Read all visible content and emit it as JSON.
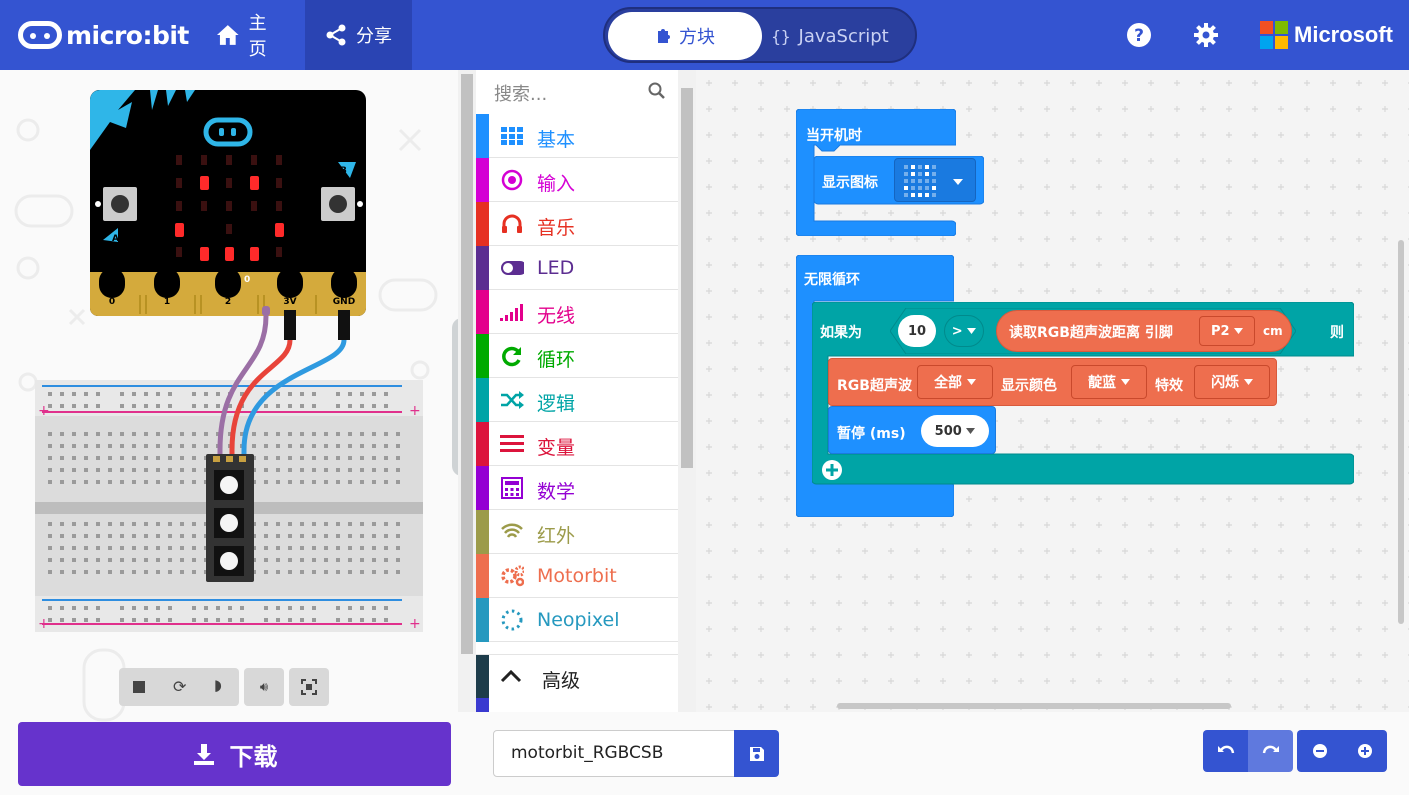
{
  "header": {
    "logo_text": "micro:bit",
    "nav_home": "主页",
    "nav_share": "分享",
    "mode_blocks": "方块",
    "mode_js": "JavaScript",
    "brand": "Microsoft",
    "brand_colors": [
      "#F25022",
      "#7FBA00",
      "#00A4EF",
      "#FFB900"
    ]
  },
  "simulator": {
    "pins": [
      "0",
      "1",
      "2",
      "3V",
      "GND"
    ],
    "button_a": "A",
    "button_b": "B",
    "pin_zero_label": "0"
  },
  "download": {
    "label": "下载"
  },
  "toolbox": {
    "search_placeholder": "搜索...",
    "categories": [
      {
        "label": "基本",
        "color": "#1E90FF",
        "icon": "grid-icon"
      },
      {
        "label": "输入",
        "color": "#D400D4",
        "icon": "radio-icon"
      },
      {
        "label": "音乐",
        "color": "#E63022",
        "icon": "headphones-icon"
      },
      {
        "label": "LED",
        "color": "#5C2D91",
        "icon": "toggle-icon"
      },
      {
        "label": "无线",
        "color": "#E3008C",
        "icon": "signal-bars-icon"
      },
      {
        "label": "循环",
        "color": "#00AA00",
        "icon": "refresh-icon"
      },
      {
        "label": "逻辑",
        "color": "#00A4A6",
        "icon": "shuffle-icon"
      },
      {
        "label": "变量",
        "color": "#DC143C",
        "icon": "list-lines-icon"
      },
      {
        "label": "数学",
        "color": "#9400D3",
        "icon": "calculator-icon"
      },
      {
        "label": "红外",
        "color": "#9C9B4A",
        "icon": "wifi-icon"
      },
      {
        "label": "Motorbit",
        "color": "#EE6E4E",
        "icon": "gears-icon"
      },
      {
        "label": "Neopixel",
        "color": "#2699BF",
        "icon": "dotted-circle-icon"
      }
    ],
    "advanced": "高级"
  },
  "workspace": {
    "on_start": "当开机时",
    "show_icon": "显示图标",
    "forever": "无限循环",
    "if_label": "如果为",
    "if_value": "10",
    "compare_op": ">",
    "read_distance": "读取RGB超声波距离 引脚",
    "pin_value": "P2",
    "unit": "cm",
    "then_label": "则",
    "rgb_label": "RGB超声波",
    "rgb_target": "全部",
    "show_color": "显示颜色",
    "color_value": "靛蓝",
    "effect_label": "特效",
    "effect_value": "闪烁",
    "pause_label": "暂停 (ms)",
    "pause_value": "500",
    "colors": {
      "basic": "#1E90FF",
      "logic": "#00A4A6",
      "motorbit": "#EE6E4E"
    }
  },
  "bottom": {
    "project_name": "motorbit_RGBCSB"
  }
}
